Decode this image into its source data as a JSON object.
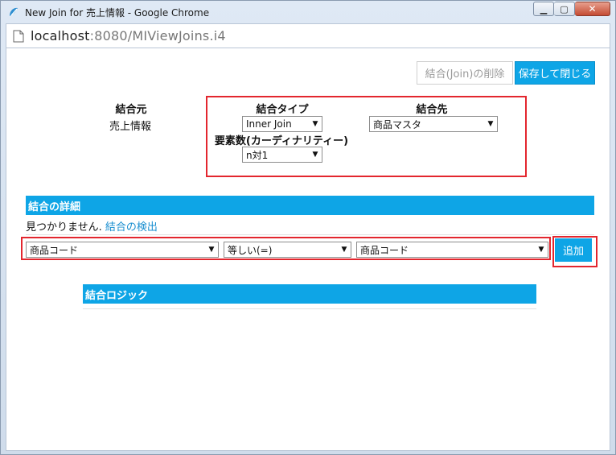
{
  "window": {
    "title": "New Join for 売上情報 - Google Chrome",
    "url_host": "localhost",
    "url_rest": ":8080/MIViewJoins.i4"
  },
  "toolbar": {
    "delete_label": "結合(Join)の削除",
    "save_close_label": "保存して閉じる"
  },
  "join": {
    "source_heading": "結合元",
    "source_value": "売上情報",
    "type_heading": "結合タイプ",
    "type_value": "Inner Join",
    "target_heading": "結合先",
    "target_value": "商品マスタ",
    "cardinality_heading": "要素数(カーディナリティー)",
    "cardinality_value": "n対1"
  },
  "details": {
    "heading": "結合の詳細",
    "not_found_text": "見つかりません.",
    "detect_link": "結合の検出",
    "left_field": "商品コード",
    "operator": "等しい(=)",
    "right_field": "商品コード",
    "add_label": "追加"
  },
  "logic": {
    "heading": "結合ロジック"
  },
  "colors": {
    "accent": "#0ea5e6",
    "highlight": "#e3262e"
  }
}
